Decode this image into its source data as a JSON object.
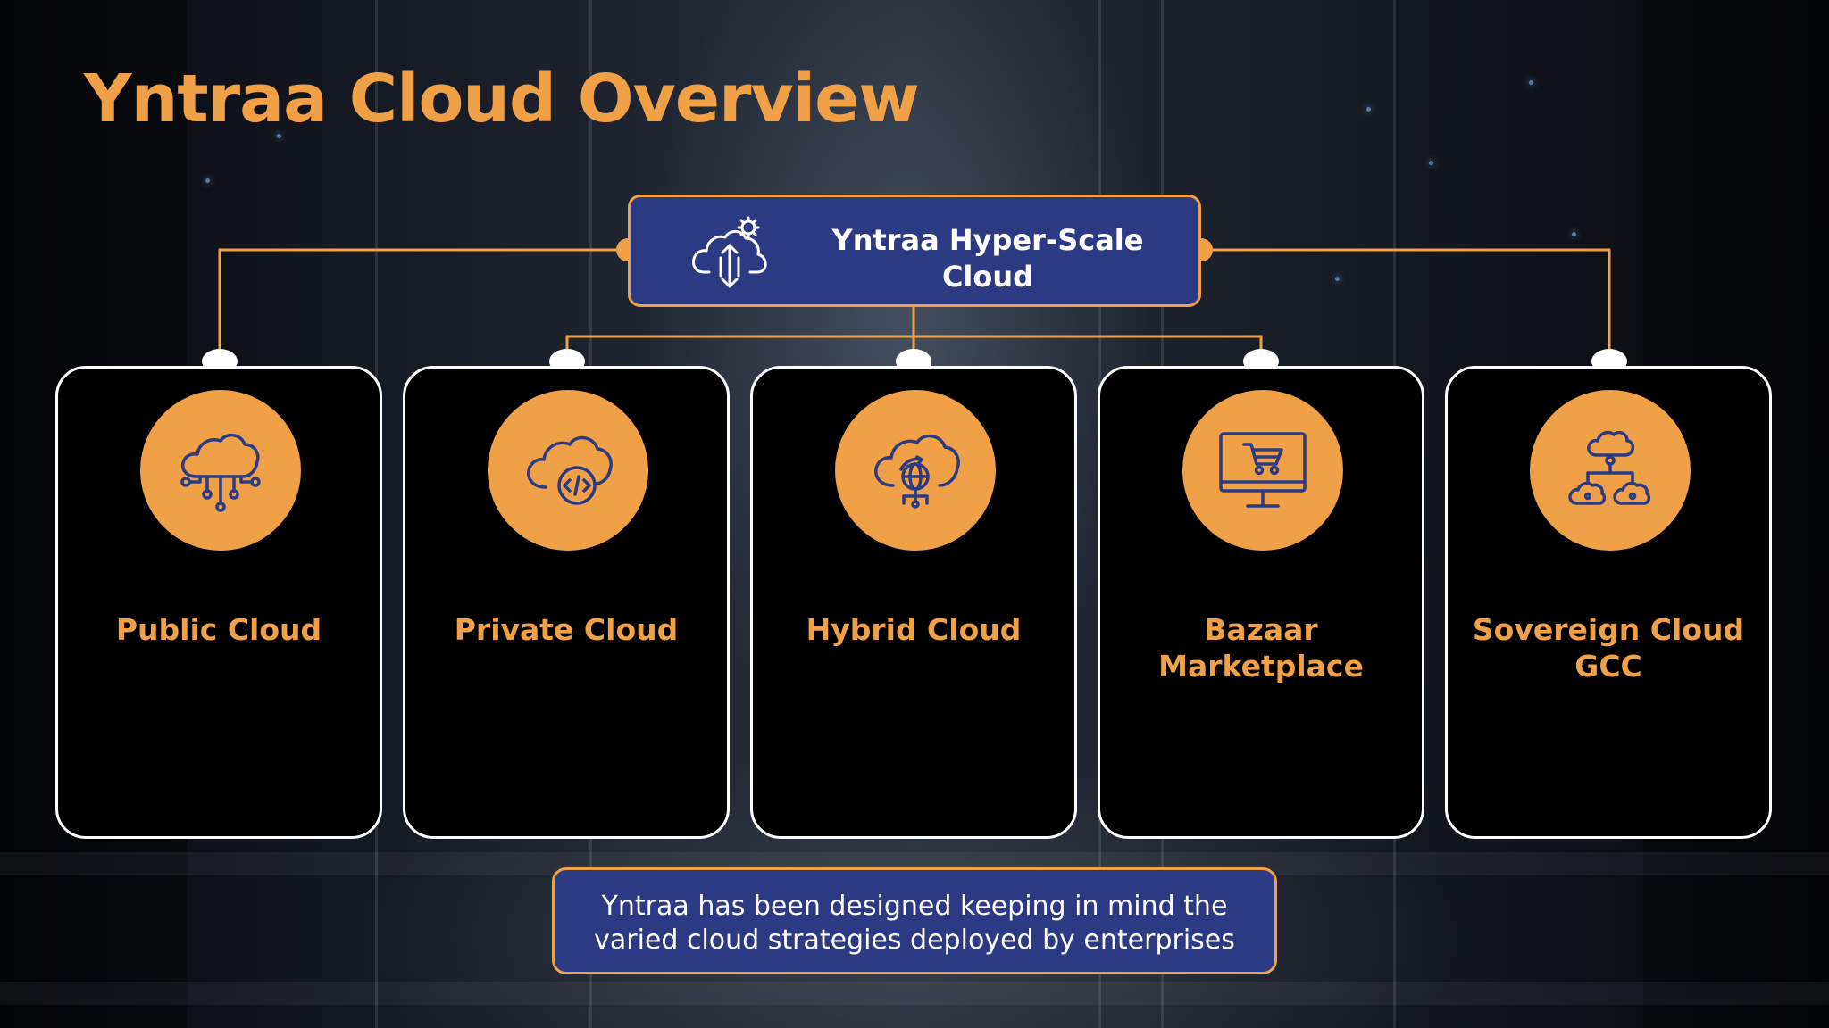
{
  "title": "Yntraa Cloud Overview",
  "hub": {
    "label": "Yntraa Hyper-Scale Cloud",
    "icon": "cloud-upload-download-gear-icon"
  },
  "cards": [
    {
      "label": "Public Cloud",
      "icon": "cloud-network-icon"
    },
    {
      "label": "Private Cloud",
      "icon": "cloud-code-icon"
    },
    {
      "label": "Hybrid Cloud",
      "icon": "cloud-globe-icon"
    },
    {
      "label": "Bazaar Marketplace",
      "icon": "shopping-cart-monitor-icon"
    },
    {
      "label": "Sovereign Cloud GCC",
      "icon": "cloud-hierarchy-icon"
    }
  ],
  "note": "Yntraa has been designed keeping in mind the varied cloud strategies deployed by enterprises",
  "colors": {
    "accent": "#f0a046",
    "navy": "#2b3a82",
    "card_bg": "#000000",
    "card_border": "#ffffff"
  }
}
